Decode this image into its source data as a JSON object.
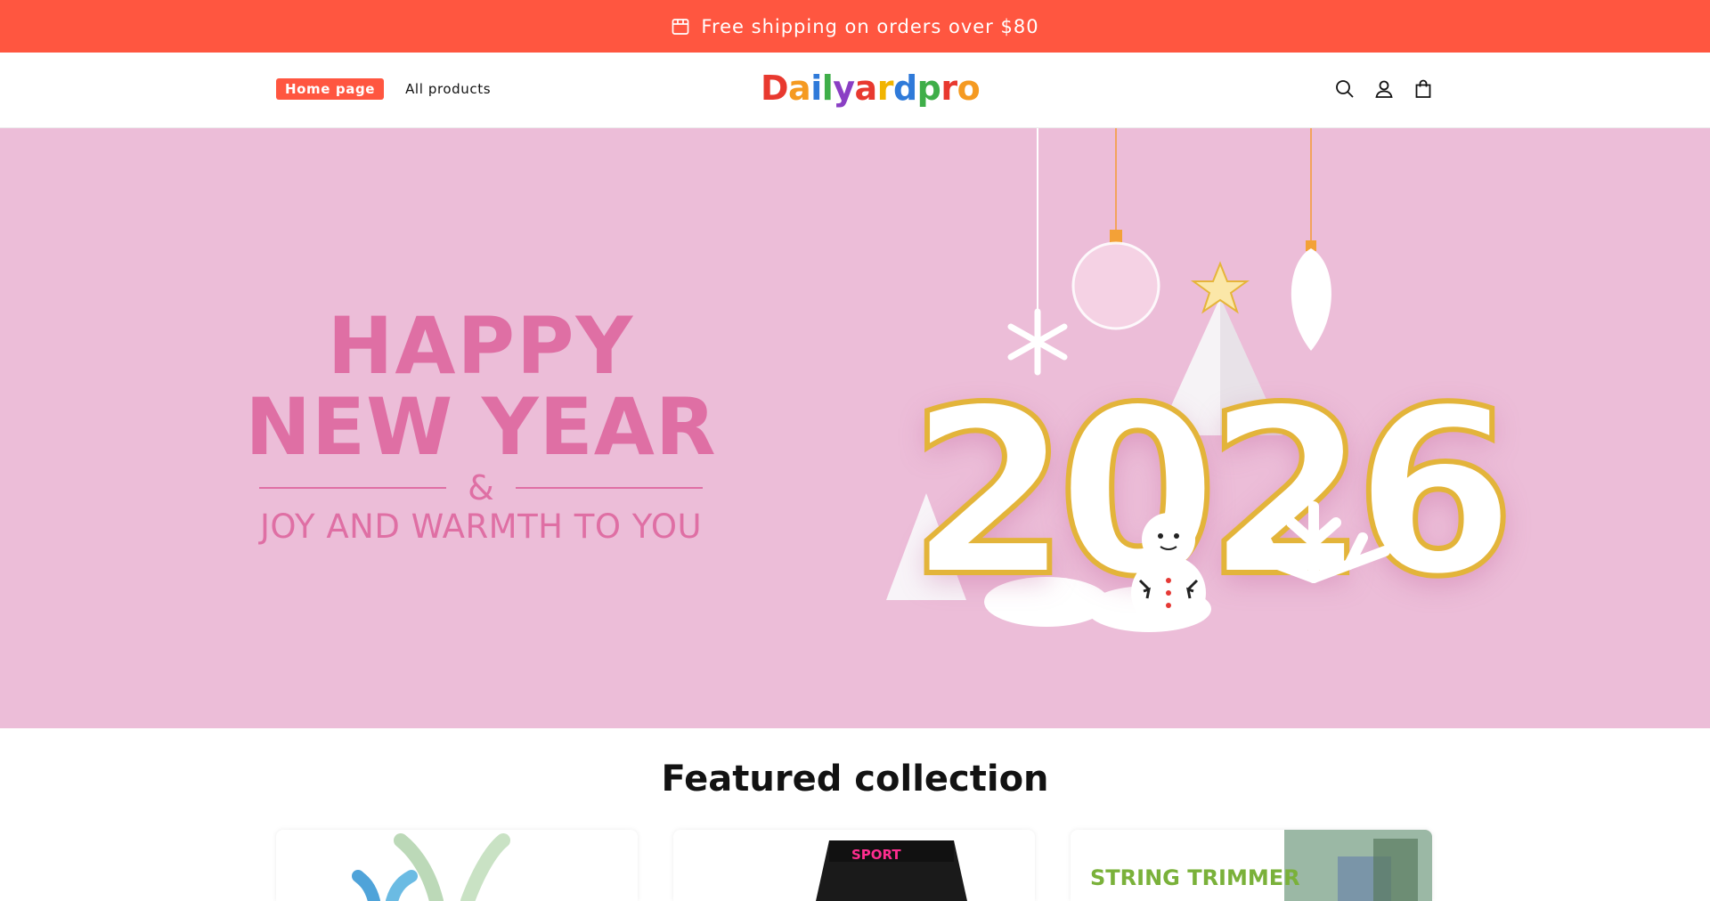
{
  "announcement": {
    "text": "Free shipping on orders over $80",
    "icon": "store-icon"
  },
  "header": {
    "nav": [
      {
        "label": "Home page",
        "active": true
      },
      {
        "label": "All products",
        "active": false
      }
    ],
    "logo": "Dailyardpro",
    "icons": [
      "search-icon",
      "account-icon",
      "cart-icon"
    ]
  },
  "hero": {
    "line1": "HAPPY",
    "line2": "NEW YEAR",
    "ampersand": "&",
    "line3": "JOY AND WARMTH TO YOU",
    "year": "2026",
    "background_color": "#ecbdd8",
    "text_color": "#df6fa4"
  },
  "featured": {
    "title": "Featured collection",
    "cards": [
      {
        "image": "product-image-plants"
      },
      {
        "image": "product-image-sport-shorts",
        "text": "SPORT"
      },
      {
        "image": "product-image-string-trimmer",
        "text": "STRING TRIMMER"
      }
    ]
  },
  "colors": {
    "accent": "#ff5640"
  }
}
